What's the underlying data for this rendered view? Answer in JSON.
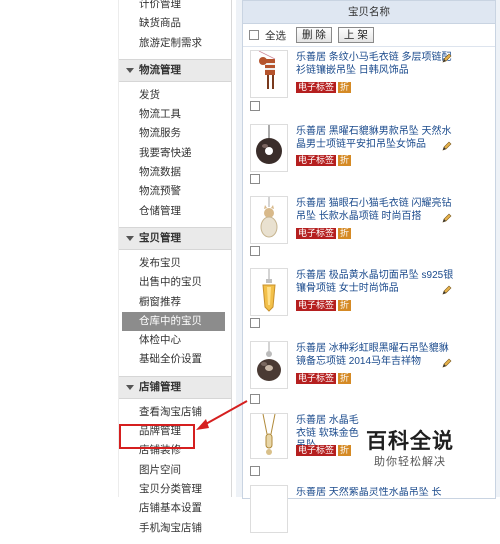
{
  "sidebar": {
    "top_items": [
      "计价管理",
      "缺货商品",
      "旅游定制需求"
    ],
    "sections": [
      {
        "title": "物流管理",
        "items": [
          "发货",
          "物流工具",
          "物流服务",
          "我要寄快递",
          "物流数据",
          "物流预警",
          "仓储管理"
        ]
      },
      {
        "title": "宝贝管理",
        "items": [
          "发布宝贝",
          "出售中的宝贝",
          "橱窗推荐",
          "仓库中的宝贝",
          "体检中心",
          "基础全价设置"
        ],
        "active": "仓库中的宝贝"
      },
      {
        "title": "店铺管理",
        "items": [
          "查看淘宝店铺",
          "品牌管理",
          "店铺装修",
          "图片空间",
          "宝贝分类管理",
          "店铺基本设置",
          "手机淘宝店铺"
        ]
      }
    ]
  },
  "table": {
    "header": "宝贝名称",
    "select_all": "全选",
    "delete_btn": "删 除",
    "list_btn": "上 架"
  },
  "products": [
    {
      "title": "乐善居 条纹小马毛衣链 多层项链配衫链镶嵌吊坠 日韩风饰品",
      "badge": "电子标签",
      "discount": "折"
    },
    {
      "title": "乐善居 黑曜石貔貅男款吊坠 天然水晶男士项链平安扣吊坠女饰品",
      "badge": "电子标签",
      "discount": "折"
    },
    {
      "title": "乐善居 猫眼石小猫毛衣链 闪耀亮钻吊坠 长款水晶项链 时尚百搭",
      "badge": "电子标签",
      "discount": "折"
    },
    {
      "title": "乐善居 极品黄水晶切面吊坠 s925银镶骨项链 女士时尚饰品",
      "badge": "电子标签",
      "discount": "折"
    },
    {
      "title": "乐善居 冰种彩虹眼黑曜石吊坠貔貅镜备忘项链 2014马年吉祥物",
      "badge": "电子标签",
      "discount": "折"
    },
    {
      "title": "乐善居 水晶毛衣链 软珠金色吊坠",
      "badge": "电子标签",
      "discount": "折"
    },
    {
      "title": "乐善居 天然紫晶灵性水晶吊坠 长",
      "badge": "",
      "discount": ""
    }
  ],
  "watermark": {
    "title": "百科全说",
    "subtitle": "助你轻松解决"
  },
  "colors": {
    "active_bg": "#8c8c8c",
    "highlight_box": "#d51f1f",
    "badge": "#b51f1f",
    "link": "#1a4a8c"
  }
}
